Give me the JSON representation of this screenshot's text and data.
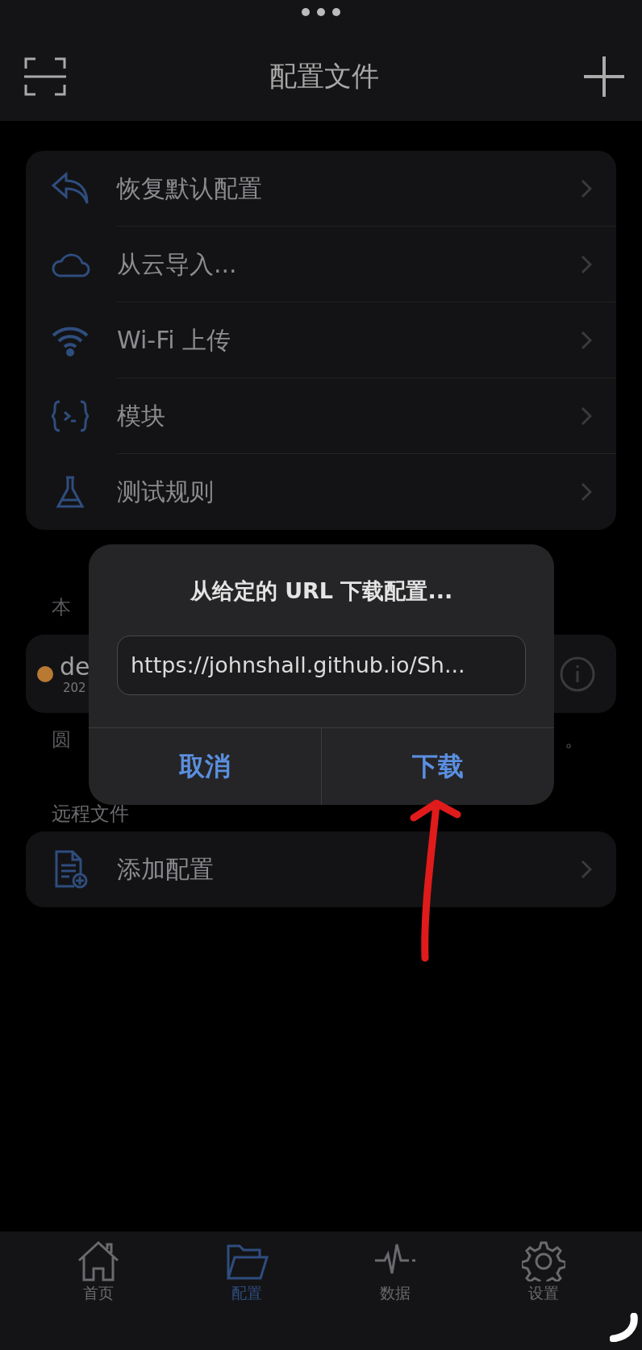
{
  "header": {
    "title": "配置文件"
  },
  "menu": [
    {
      "label": "恢复默认配置",
      "kind": "undo"
    },
    {
      "label": "从云导入...",
      "kind": "cloud"
    },
    {
      "label": "Wi-Fi 上传",
      "kind": "wifi"
    },
    {
      "label": "模块",
      "kind": "module"
    },
    {
      "label": "测试规则",
      "kind": "flask"
    }
  ],
  "local": {
    "heading": "本",
    "profile_name": "de",
    "profile_date": "202",
    "note_start": "圆",
    "note_end": "。"
  },
  "remote": {
    "heading": "远程文件",
    "items": [
      {
        "label": "添加配置"
      }
    ]
  },
  "dialog": {
    "title": "从给定的 URL 下载配置...",
    "value": "https://johnshall.github.io/Sh...",
    "buttons": [
      "取消",
      "下载"
    ]
  },
  "tabs": [
    {
      "label": "首页",
      "kind": "home",
      "selected": false
    },
    {
      "label": "配置",
      "kind": "folder",
      "selected": true
    },
    {
      "label": "数据",
      "kind": "pulse",
      "selected": false
    },
    {
      "label": "设置",
      "kind": "gear",
      "selected": false
    }
  ]
}
